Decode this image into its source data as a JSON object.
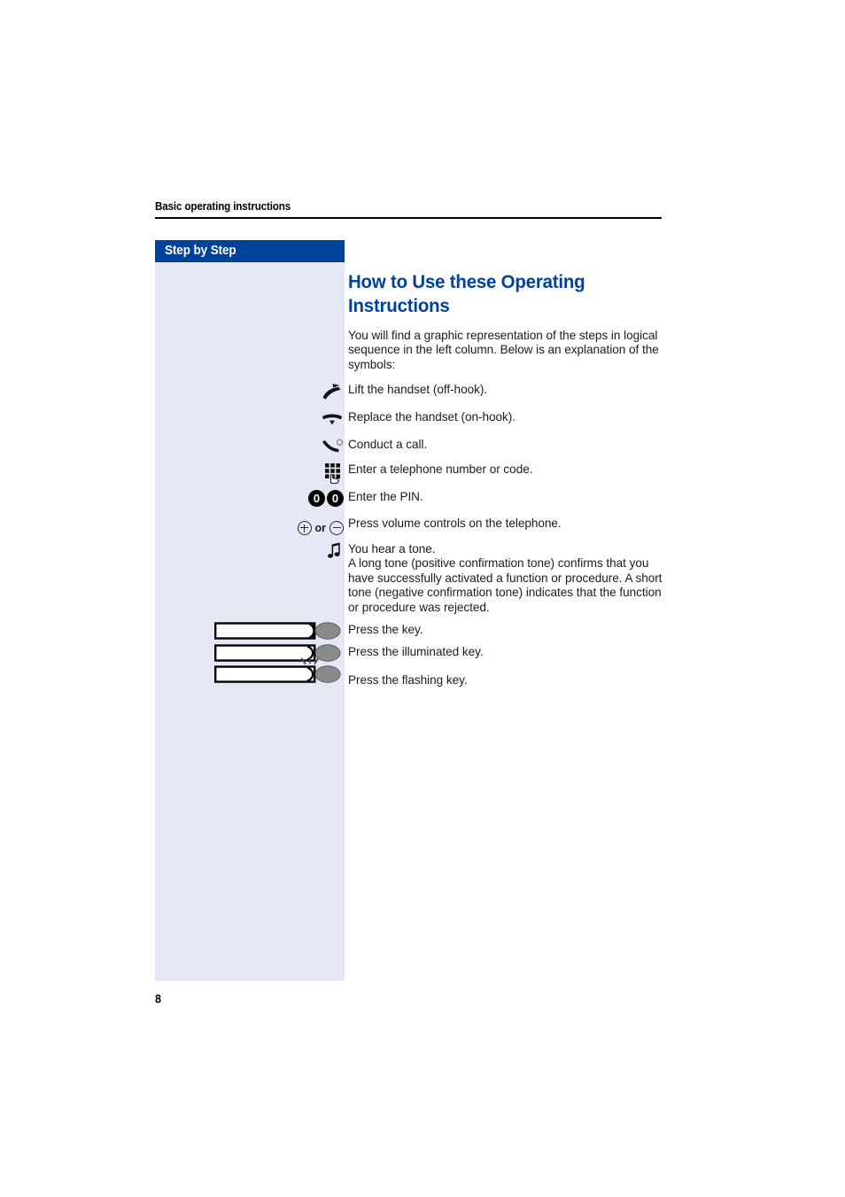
{
  "page": {
    "running_header": "Basic operating instructions",
    "folio": "8",
    "colors": {
      "brand_blue": "#00419a",
      "panel_blue": "#e4e8f4",
      "body_text": "#1c1c1c"
    }
  },
  "sidebar": {
    "band_label": "Step by Step"
  },
  "main": {
    "title": "How to Use these Operating Instructions",
    "intro": "You will find a graphic representation of the steps in logical sequence in the left column. Below is an explanation of the symbols:",
    "symbols": [
      {
        "icon": "lift-handset-icon",
        "text": "Lift the handset (off-hook)."
      },
      {
        "icon": "replace-handset-icon",
        "text": "Replace the handset (on-hook)."
      },
      {
        "icon": "conduct-call-handset-icon",
        "text": "Conduct a call."
      },
      {
        "icon": "keypad-icon",
        "text": "Enter a telephone number or code."
      },
      {
        "icon": "pin-zero-zero-icon",
        "text": "Enter the PIN.",
        "badge_left": "0",
        "badge_right": "0"
      },
      {
        "icon": "volume-plus-minus-icon",
        "text": "Press volume controls on the telephone.",
        "or_label": "or"
      },
      {
        "icon": "tone-music-note-icon",
        "text": "You hear a tone.",
        "extra": "A long tone (positive confirmation tone) confirms that you have successfully activated a function or procedure. A short tone (negative confirmation tone) indicates that the function or procedure was rejected."
      }
    ],
    "keys": [
      {
        "icon": "key-plain-icon",
        "text": "Press the key."
      },
      {
        "icon": "key-illuminated-icon",
        "text": "Press the illuminated key."
      },
      {
        "icon": "key-flashing-icon",
        "text": "Press the flashing key."
      }
    ]
  }
}
